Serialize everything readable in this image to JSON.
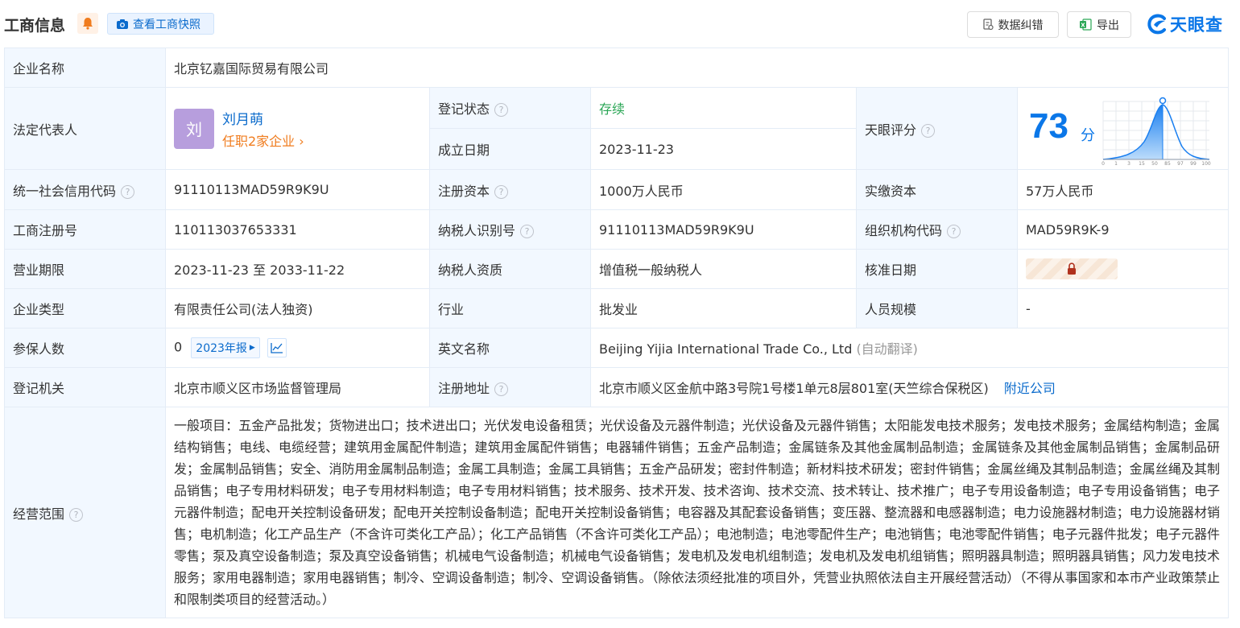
{
  "header": {
    "title": "工商信息",
    "snapshot_label": "查看工商快照",
    "correct_label": "数据纠错",
    "export_label": "导出",
    "brand": "天眼查"
  },
  "company": {
    "name_label": "企业名称",
    "name": "北京钇嘉国际贸易有限公司",
    "legal_label": "法定代表人",
    "legal_avatar": "刘",
    "legal_name": "刘月萌",
    "legal_sub": "任职2家企业",
    "status_label": "登记状态",
    "status": "存续",
    "found_label": "成立日期",
    "found": "2023-11-23",
    "score_label": "天眼评分",
    "score": "73",
    "score_unit": "分",
    "score_ticks": [
      "0",
      "1",
      "3",
      "15",
      "50",
      "85",
      "97",
      "99",
      "100"
    ],
    "credit_label": "统一社会信用代码",
    "credit": "91110113MAD59R9K9U",
    "capital_label": "注册资本",
    "capital": "1000万人民币",
    "paid_label": "实缴资本",
    "paid": "57万人民币",
    "reg_no_label": "工商注册号",
    "reg_no": "110113037653331",
    "tax_id_label": "纳税人识别号",
    "tax_id": "91110113MAD59R9K9U",
    "org_code_label": "组织机构代码",
    "org_code": "MAD59R9K-9",
    "term_label": "营业期限",
    "term": "2023-11-23 至 2033-11-22",
    "taxpayer_label": "纳税人资质",
    "taxpayer": "增值税一般纳税人",
    "approve_label": "核准日期",
    "type_label": "企业类型",
    "type": "有限责任公司(法人独资)",
    "industry_label": "行业",
    "industry": "批发业",
    "staff_label": "人员规模",
    "staff": "-",
    "insured_label": "参保人数",
    "insured": "0",
    "insured_year": "2023年报",
    "en_label": "英文名称",
    "en_name": "Beijing Yijia International Trade Co., Ltd",
    "en_note": "(自动翻译)",
    "authority_label": "登记机关",
    "authority": "北京市顺义区市场监督管理局",
    "address_label": "注册地址",
    "address": "北京市顺义区金航中路3号院1号楼1单元8层801室(天竺综合保税区)",
    "nearby": "附近公司",
    "scope_label": "经营范围",
    "scope": "一般项目：五金产品批发；货物进出口；技术进出口；光伏发电设备租赁；光伏设备及元器件制造；光伏设备及元器件销售；太阳能发电技术服务；发电技术服务；金属结构制造；金属结构销售；电线、电缆经营；建筑用金属配件制造；建筑用金属配件销售；电器辅件销售；五金产品制造；金属链条及其他金属制品制造；金属链条及其他金属制品销售；金属制品研发；金属制品销售；安全、消防用金属制品制造；金属工具制造；金属工具销售；五金产品研发；密封件制造；新材料技术研发；密封件销售；金属丝绳及其制品制造；金属丝绳及其制品销售；电子专用材料研发；电子专用材料制造；电子专用材料销售；技术服务、技术开发、技术咨询、技术交流、技术转让、技术推广；电子专用设备制造；电子专用设备销售；电子元器件制造；配电开关控制设备研发；配电开关控制设备制造；配电开关控制设备销售；电容器及其配套设备销售；变压器、整流器和电感器制造；电力设施器材制造；电力设施器材销售；电机制造；化工产品生产（不含许可类化工产品）；化工产品销售（不含许可类化工产品）；电池制造；电池零配件生产；电池销售；电池零配件销售；电子元器件批发；电子元器件零售；泵及真空设备制造；泵及真空设备销售；机械电气设备制造；机械电气设备销售；发电机及发电机组制造；发电机及发电机组销售；照明器具制造；照明器具销售；风力发电技术服务；家用电器制造；家用电器销售；制冷、空调设备制造；制冷、空调设备销售。（除依法须经批准的项目外，凭营业执照依法自主开展经营活动）（不得从事国家和本市产业政策禁止和限制类项目的经营活动。）"
  }
}
